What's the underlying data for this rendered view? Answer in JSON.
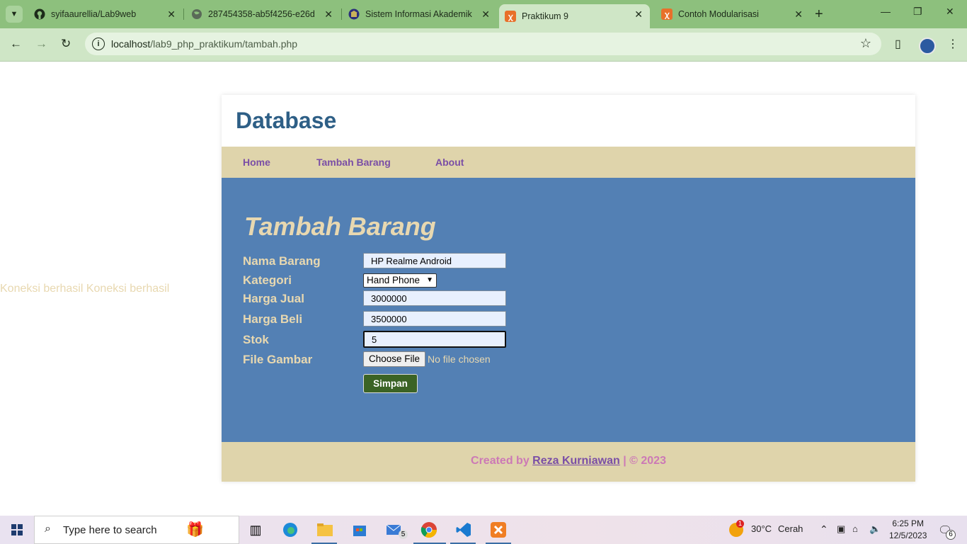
{
  "browser": {
    "tabs": [
      {
        "title": "syifaaurellia/Lab9web",
        "icon": "github-icon"
      },
      {
        "title": "287454358-ab5f4256-e26d-",
        "icon": "globe-icon"
      },
      {
        "title": "Sistem Informasi Akademik",
        "icon": "university-icon"
      },
      {
        "title": "Praktikum 9",
        "icon": "xampp-icon",
        "active": true
      },
      {
        "title": "Contoh Modularisasi",
        "icon": "xampp-icon"
      }
    ],
    "url_host": "localhost",
    "url_path": "/lab9_php_praktikum/tambah.php"
  },
  "page": {
    "left_message": "Koneksi berhasil Koneksi berhasil",
    "site_title": "Database",
    "nav": [
      "Home",
      "Tambah Barang",
      "About"
    ],
    "heading": "Tambah Barang",
    "form": {
      "nama_label": "Nama Barang",
      "nama_value": "HP Realme Android",
      "kategori_label": "Kategori",
      "kategori_value": "Hand Phone",
      "harga_jual_label": "Harga Jual",
      "harga_jual_value": "3000000",
      "harga_beli_label": "Harga Beli",
      "harga_beli_value": "3500000",
      "stok_label": "Stok",
      "stok_value": "5",
      "file_label": "File Gambar",
      "file_button": "Choose File",
      "file_status": "No file chosen",
      "submit": "Simpan"
    },
    "footer": {
      "prefix": "Created by",
      "author": "Reza Kurniawan",
      "suffix": "| © 2023"
    }
  },
  "taskbar": {
    "search_placeholder": "Type here to search",
    "mail_badge": "5",
    "weather_temp": "30°C",
    "weather_desc": "Cerah",
    "weather_alert": "1",
    "time": "6:25 PM",
    "date": "12/5/2023",
    "notif_count": "6"
  },
  "colors": {
    "accent_nav": "#7a4ea6",
    "main_bg": "#5380b4",
    "nav_bg": "#dfd4ab",
    "text_cream": "#e8d8b0",
    "save_button": "#3b6325"
  }
}
